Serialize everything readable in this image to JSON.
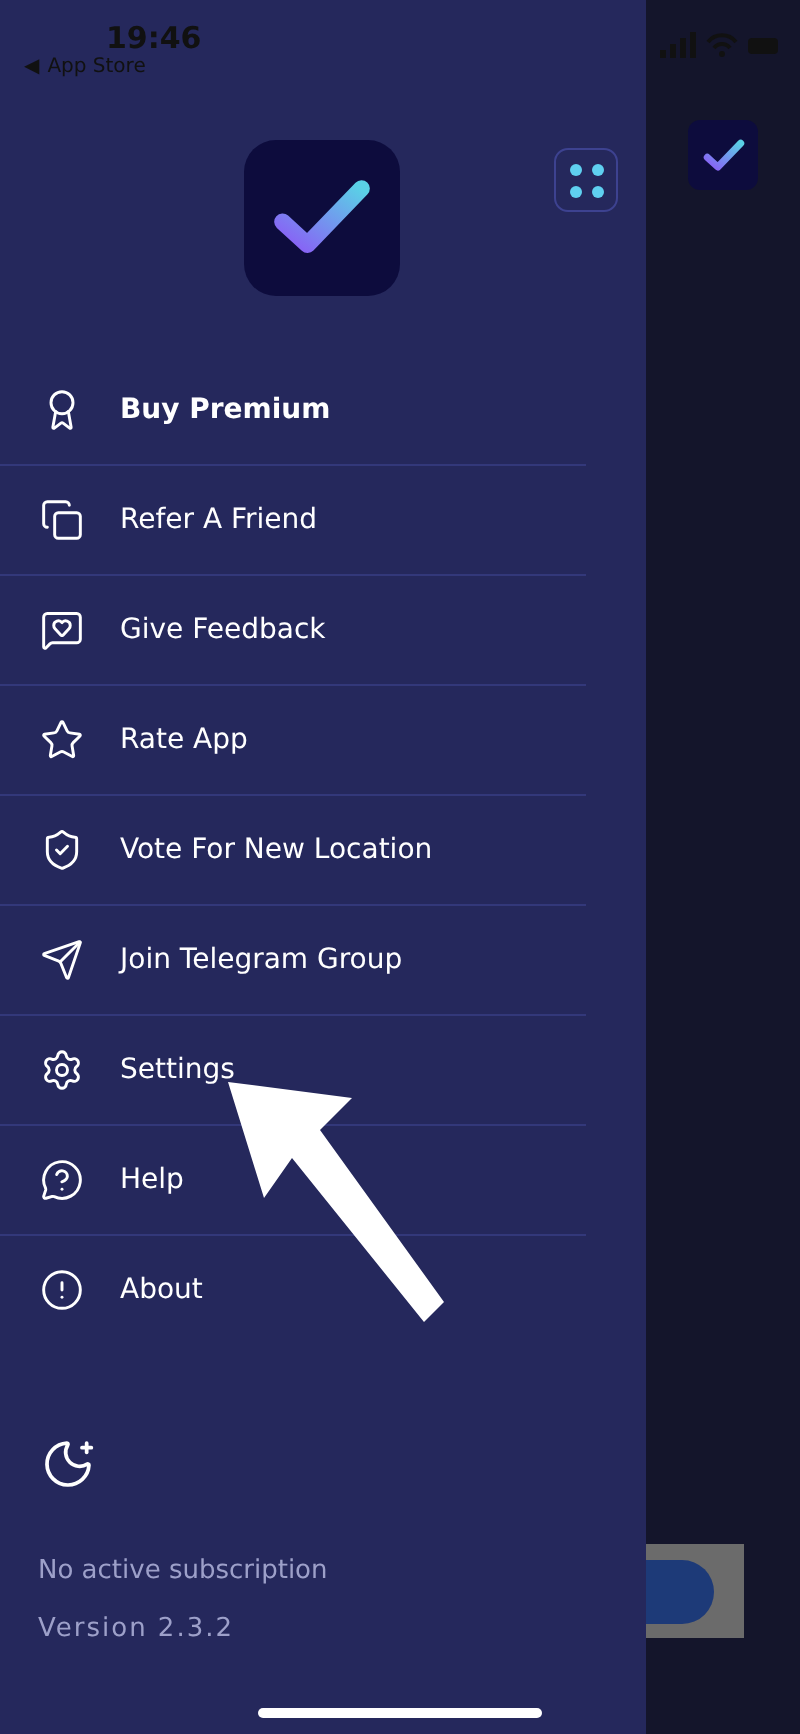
{
  "status_bar": {
    "time": "19:46",
    "back_arrow": "◀",
    "back_label": "App Store"
  },
  "menu": [
    {
      "label": "Buy Premium",
      "bold": true
    },
    {
      "label": "Refer A Friend",
      "bold": false
    },
    {
      "label": "Give Feedback",
      "bold": false
    },
    {
      "label": "Rate App",
      "bold": false
    },
    {
      "label": "Vote For New Location",
      "bold": false
    },
    {
      "label": "Join Telegram Group",
      "bold": false
    },
    {
      "label": "Settings",
      "bold": false
    },
    {
      "label": "Help",
      "bold": false
    },
    {
      "label": "About",
      "bold": false
    }
  ],
  "footer": {
    "subscription": "No active subscription",
    "version": "Version 2.3.2"
  }
}
